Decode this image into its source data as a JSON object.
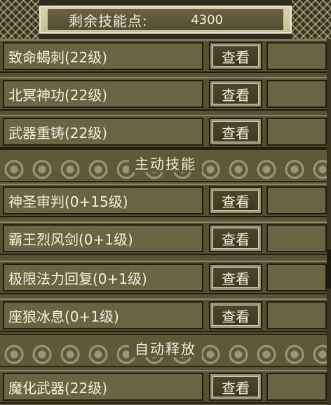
{
  "header": {
    "label": "剩余技能点:",
    "points": "4300"
  },
  "button_label": "查看",
  "rows_top": [
    {
      "name": "致命蝎刺(22级)",
      "button": "查看"
    },
    {
      "name": "北冥神功(22级)",
      "button": "查看"
    },
    {
      "name": "武器重铸(22级)",
      "button": "查看"
    }
  ],
  "section_active": "主动技能",
  "rows_active": [
    {
      "name": "神圣审判(0+15级)",
      "button": "查看"
    },
    {
      "name": "霸王烈风剑(0+1级)",
      "button": "查看"
    },
    {
      "name": "极限法力回复(0+1级)",
      "button": "查看"
    },
    {
      "name": "座狼冰息(0+1级)",
      "button": "查看"
    }
  ],
  "section_auto": "自动释放",
  "rows_auto": [
    {
      "name": "魔化武器(22级)",
      "button": "查看"
    }
  ]
}
